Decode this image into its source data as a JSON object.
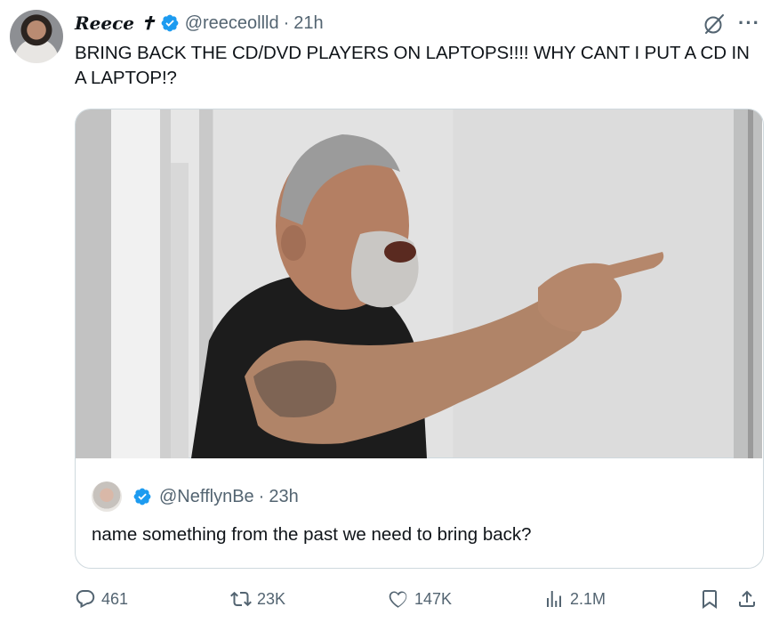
{
  "author": {
    "display_name": "Reece ✝",
    "handle": "@reeceollld",
    "time": "21h",
    "avatar_icon": "profile-photo-icon"
  },
  "tweet": {
    "text": "BRING BACK THE CD/DVD PLAYERS ON LAPTOPS!!!! WHY CANT I PUT A CD IN A LAPTOP!?"
  },
  "quoted": {
    "handle": "@NefflynBe",
    "time": "23h",
    "text": "name something from the past we need to bring back?"
  },
  "actions": {
    "replies": "461",
    "retweets": "23K",
    "likes": "147K",
    "views": "2.1M"
  },
  "colors": {
    "verified": "#1d9bf0",
    "muted": "#536471",
    "border": "#cfd9de"
  }
}
